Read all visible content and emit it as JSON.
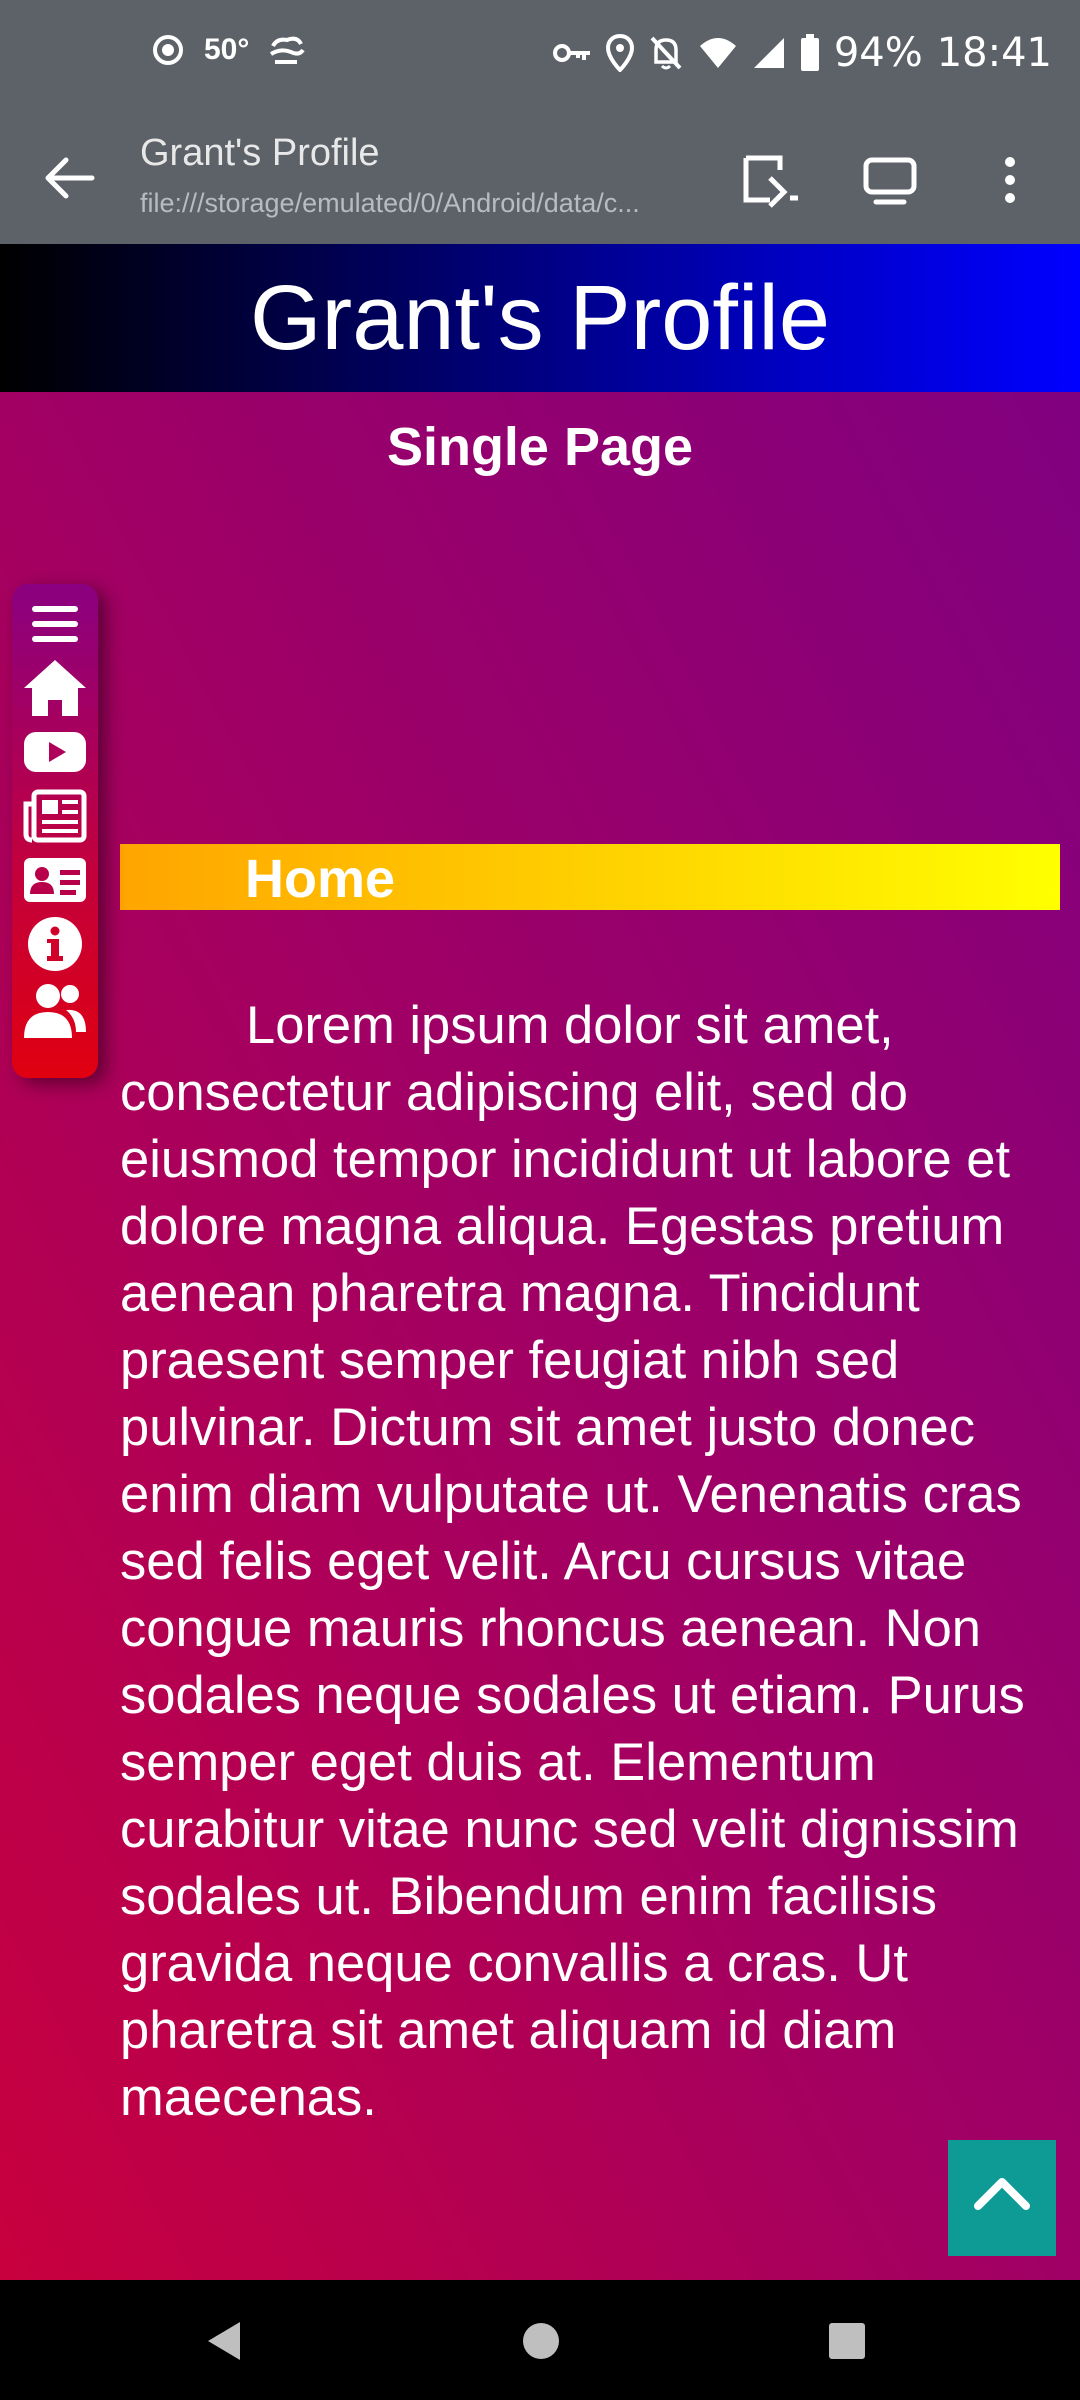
{
  "status_bar": {
    "temperature": "50°",
    "battery": "94%",
    "time": "18:41"
  },
  "browser": {
    "page_title": "Grant's Profile",
    "url": "file:///storage/emulated/0/Android/data/c..."
  },
  "page": {
    "banner_title": "Grant's Profile",
    "subtitle": "Single Page",
    "section_heading": "Home",
    "body_text": "Lorem ipsum dolor sit amet, consectetur adipiscing elit, sed do eiusmod tempor incididunt ut labore et dolore magna aliqua. Egestas pretium aenean pharetra magna. Tincidunt praesent semper feugiat nibh sed pulvinar. Dictum sit amet justo donec enim diam vulputate ut. Venenatis cras sed felis eget velit. Arcu cursus vitae congue mauris rhoncus aenean. Non sodales neque sodales ut etiam. Purus semper eget duis at. Elementum curabitur vitae nunc sed velit dignissim sodales ut. Bibendum enim facilisis gravida neque convallis a cras. Ut pharetra sit amet aliquam id diam maecenas."
  },
  "side_nav": [
    "menu-icon",
    "home-icon",
    "youtube-icon",
    "newspaper-icon",
    "id-card-icon",
    "info-icon",
    "users-icon"
  ],
  "colors": {
    "chrome": "#5d6268",
    "scroll_top_button": "#0f9b95",
    "section_bar_start": "#ffa500",
    "section_bar_end": "#ffff00"
  }
}
